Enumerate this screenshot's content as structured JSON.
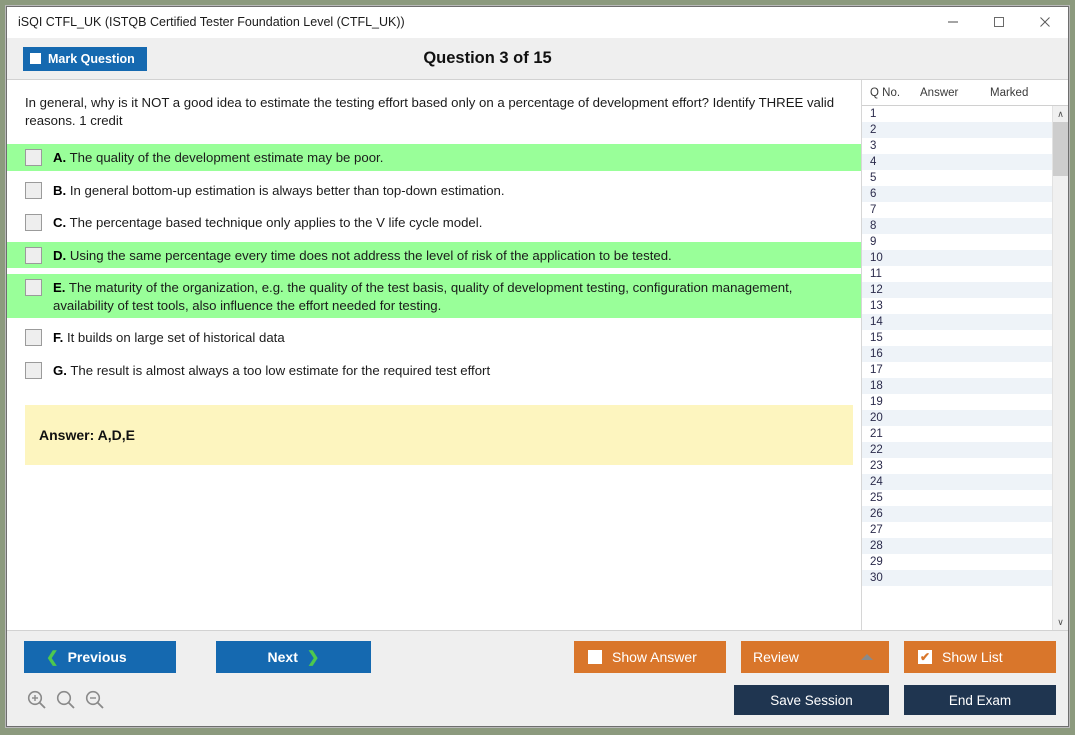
{
  "window": {
    "title": "iSQI CTFL_UK (ISTQB Certified Tester Foundation Level (CTFL_UK))",
    "minimize_label": "Minimize",
    "maximize_label": "Maximize",
    "close_label": "Close"
  },
  "header": {
    "mark_question_label": "Mark Question",
    "mark_question_checked": false,
    "question_counter": "Question 3 of 15"
  },
  "question": {
    "text": "In general, why is it NOT a good idea to estimate the testing effort based only on a percentage of development effort? Identify THREE valid reasons. 1 credit",
    "options": [
      {
        "letter": "A.",
        "text": "The quality of the development estimate may be poor.",
        "correct": true,
        "checked": false
      },
      {
        "letter": "B.",
        "text": "In general bottom-up estimation is always better than top-down estimation.",
        "correct": false,
        "checked": false
      },
      {
        "letter": "C.",
        "text": "The percentage based technique only applies to the V life cycle model.",
        "correct": false,
        "checked": false
      },
      {
        "letter": "D.",
        "text": "Using the same percentage every time does not address the level of risk of the application to be tested.",
        "correct": true,
        "checked": false
      },
      {
        "letter": "E.",
        "text": "The maturity of the organization, e.g. the quality of the test basis, quality of development testing, configuration management, availability of test tools, also influence the effort needed for testing.",
        "correct": true,
        "checked": false
      },
      {
        "letter": "F.",
        "text": "It builds on large set of historical data",
        "correct": false,
        "checked": false
      },
      {
        "letter": "G.",
        "text": "The result is almost always a too low estimate for the required test effort",
        "correct": false,
        "checked": false
      }
    ],
    "answer_label": "Answer: A,D,E"
  },
  "list_panel": {
    "columns": [
      "Q No.",
      "Answer",
      "Marked"
    ],
    "rows": [
      {
        "qno": "1",
        "answer": "",
        "marked": ""
      },
      {
        "qno": "2",
        "answer": "",
        "marked": ""
      },
      {
        "qno": "3",
        "answer": "",
        "marked": ""
      },
      {
        "qno": "4",
        "answer": "",
        "marked": ""
      },
      {
        "qno": "5",
        "answer": "",
        "marked": ""
      },
      {
        "qno": "6",
        "answer": "",
        "marked": ""
      },
      {
        "qno": "7",
        "answer": "",
        "marked": ""
      },
      {
        "qno": "8",
        "answer": "",
        "marked": ""
      },
      {
        "qno": "9",
        "answer": "",
        "marked": ""
      },
      {
        "qno": "10",
        "answer": "",
        "marked": ""
      },
      {
        "qno": "11",
        "answer": "",
        "marked": ""
      },
      {
        "qno": "12",
        "answer": "",
        "marked": ""
      },
      {
        "qno": "13",
        "answer": "",
        "marked": ""
      },
      {
        "qno": "14",
        "answer": "",
        "marked": ""
      },
      {
        "qno": "15",
        "answer": "",
        "marked": ""
      },
      {
        "qno": "16",
        "answer": "",
        "marked": ""
      },
      {
        "qno": "17",
        "answer": "",
        "marked": ""
      },
      {
        "qno": "18",
        "answer": "",
        "marked": ""
      },
      {
        "qno": "19",
        "answer": "",
        "marked": ""
      },
      {
        "qno": "20",
        "answer": "",
        "marked": ""
      },
      {
        "qno": "21",
        "answer": "",
        "marked": ""
      },
      {
        "qno": "22",
        "answer": "",
        "marked": ""
      },
      {
        "qno": "23",
        "answer": "",
        "marked": ""
      },
      {
        "qno": "24",
        "answer": "",
        "marked": ""
      },
      {
        "qno": "25",
        "answer": "",
        "marked": ""
      },
      {
        "qno": "26",
        "answer": "",
        "marked": ""
      },
      {
        "qno": "27",
        "answer": "",
        "marked": ""
      },
      {
        "qno": "28",
        "answer": "",
        "marked": ""
      },
      {
        "qno": "29",
        "answer": "",
        "marked": ""
      },
      {
        "qno": "30",
        "answer": "",
        "marked": ""
      }
    ],
    "scroll_up_glyph": "∧",
    "scroll_down_glyph": "∨"
  },
  "footer": {
    "previous_label": "Previous",
    "previous_chevron": "❮",
    "next_label": "Next",
    "next_chevron": "❯",
    "show_answer_label": "Show Answer",
    "show_answer_checked": false,
    "review_label": "Review",
    "show_list_label": "Show List",
    "show_list_checked": true,
    "show_list_tick": "✔",
    "save_session_label": "Save Session",
    "end_exam_label": "End Exam",
    "zoom_in_label": "Zoom In",
    "zoom_reset_label": "Zoom Reset",
    "zoom_out_label": "Zoom Out"
  },
  "colors": {
    "accent_blue": "#1569b0",
    "accent_orange": "#d9762b",
    "navy": "#1f3550",
    "correct_green": "#99ff99",
    "answer_yellow": "#fdf5bf",
    "chevron_green": "#4ec84e"
  }
}
